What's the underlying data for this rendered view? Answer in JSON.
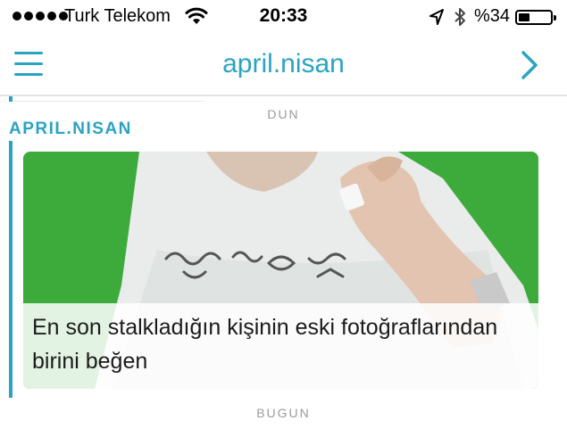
{
  "status_bar": {
    "carrier": "Turk Telekom",
    "time": "20:33",
    "battery_percent": "%34",
    "battery_level": 0.34
  },
  "nav": {
    "title": "april.nisan",
    "menu_icon": "hamburger-icon",
    "forward_icon": "chevron-right-icon"
  },
  "feed": {
    "prev_day_label": "DUN",
    "sender": "APRIL.NISAN",
    "story": {
      "caption": "En son stalkladığın kişinin eski fotoğraflarından birini beğen"
    },
    "next_day_label": "BUGUN"
  },
  "colors": {
    "accent": "#2aa3c3",
    "story_background": "#3cab3c"
  }
}
